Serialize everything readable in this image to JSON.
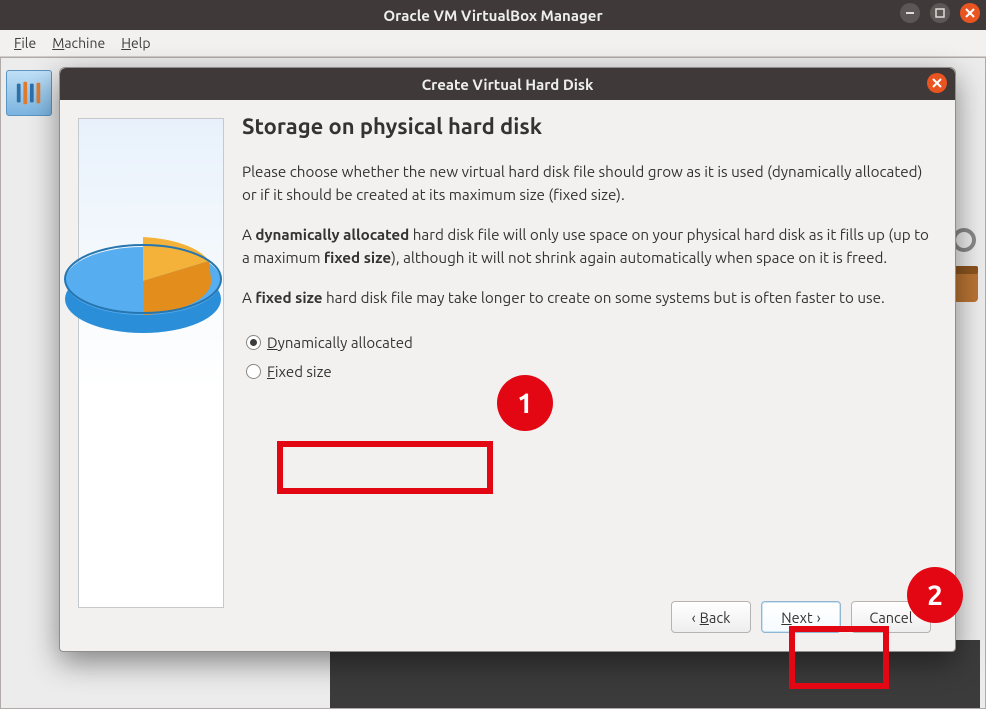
{
  "window": {
    "title": "Oracle VM VirtualBox Manager",
    "menus": {
      "file": "File",
      "machine": "Machine",
      "help": "Help"
    }
  },
  "dialog": {
    "title": "Create Virtual Hard Disk",
    "heading": "Storage on physical hard disk",
    "para1": "Please choose whether the new virtual hard disk file should grow as it is used (dynamically allocated) or if it should be created at its maximum size (fixed size).",
    "para2a": "A ",
    "para2b": "dynamically allocated",
    "para2c": " hard disk file will only use space on your physical hard disk as it fills up (up to a maximum ",
    "para2d": "fixed size",
    "para2e": "), although it will not shrink again automatically when space on it is freed.",
    "para3a": "A ",
    "para3b": "fixed size",
    "para3c": " hard disk file may take longer to create on some systems but is often faster to use.",
    "radio": {
      "opt1_pre": "D",
      "opt1_rest": "ynamically allocated",
      "opt2_pre": "F",
      "opt2_rest": "ixed size"
    },
    "buttons": {
      "back_pre": "B",
      "back_rest": "ack",
      "next_pre": "N",
      "next_rest": "ext",
      "cancel": "Cancel"
    }
  },
  "annotations": {
    "marker1": "1",
    "marker2": "2"
  }
}
